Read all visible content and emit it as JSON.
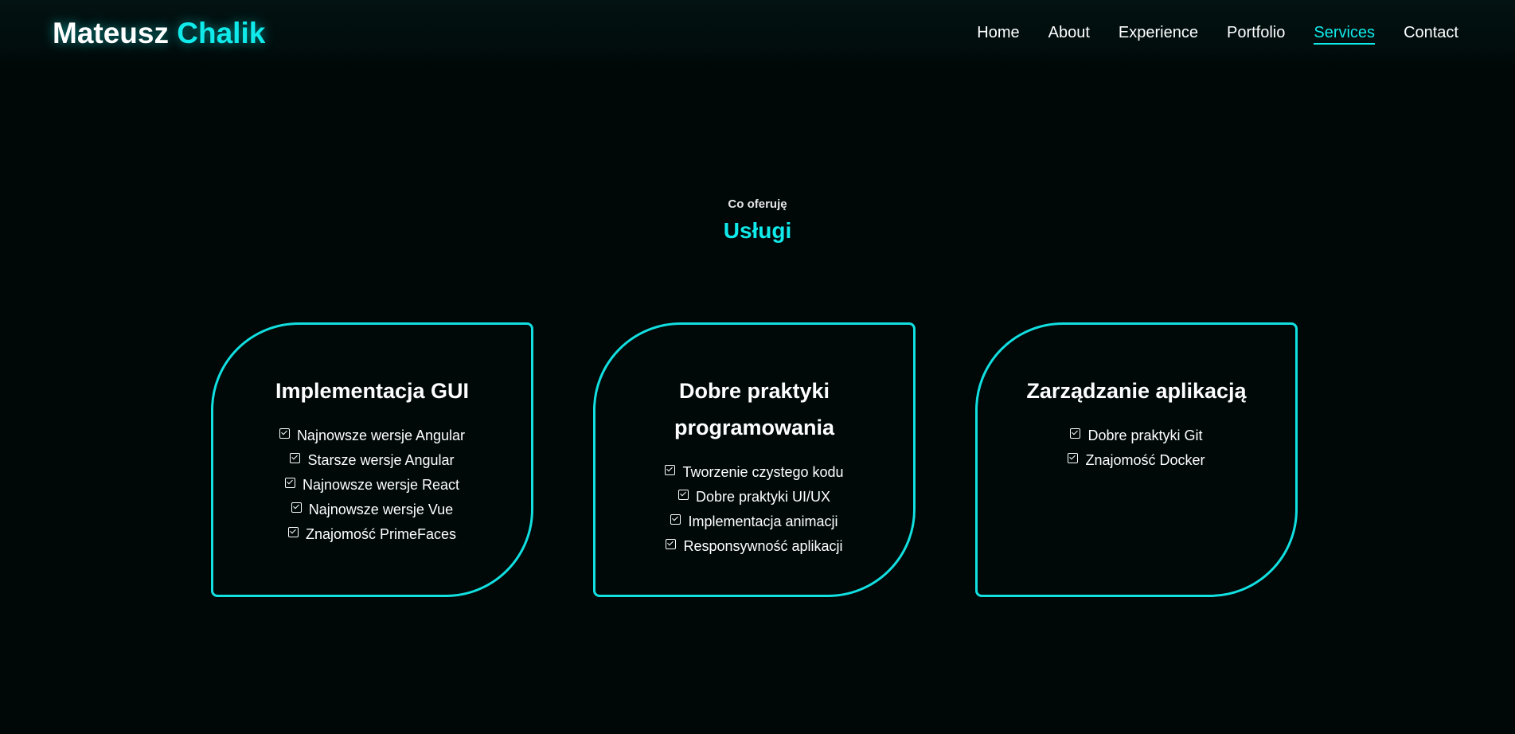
{
  "header": {
    "logo_first": "Mateusz",
    "logo_second": "Chalik",
    "nav": [
      {
        "label": "Home"
      },
      {
        "label": "About"
      },
      {
        "label": "Experience"
      },
      {
        "label": "Portfolio"
      },
      {
        "label": "Services",
        "active": true
      },
      {
        "label": "Contact"
      }
    ]
  },
  "section": {
    "subtitle": "Co oferuję",
    "title": "Usługi"
  },
  "cards": [
    {
      "title": "Implementacja GUI",
      "items": [
        "Najnowsze wersje Angular",
        "Starsze wersje Angular",
        "Najnowsze wersje React",
        "Najnowsze wersje Vue",
        "Znajomość PrimeFaces"
      ]
    },
    {
      "title": "Dobre praktyki programowania",
      "items": [
        "Tworzenie czystego kodu",
        "Dobre praktyki UI/UX",
        "Implementacja animacji",
        "Responsywność aplikacji"
      ]
    },
    {
      "title": "Zarządzanie aplikacją",
      "items": [
        "Dobre praktyki Git",
        "Znajomość Docker"
      ]
    }
  ],
  "colors": {
    "accent": "#11eaea",
    "background": "#000707",
    "text": "#ffffff"
  },
  "icons": {
    "list_item": "checkbox-checked-icon"
  }
}
